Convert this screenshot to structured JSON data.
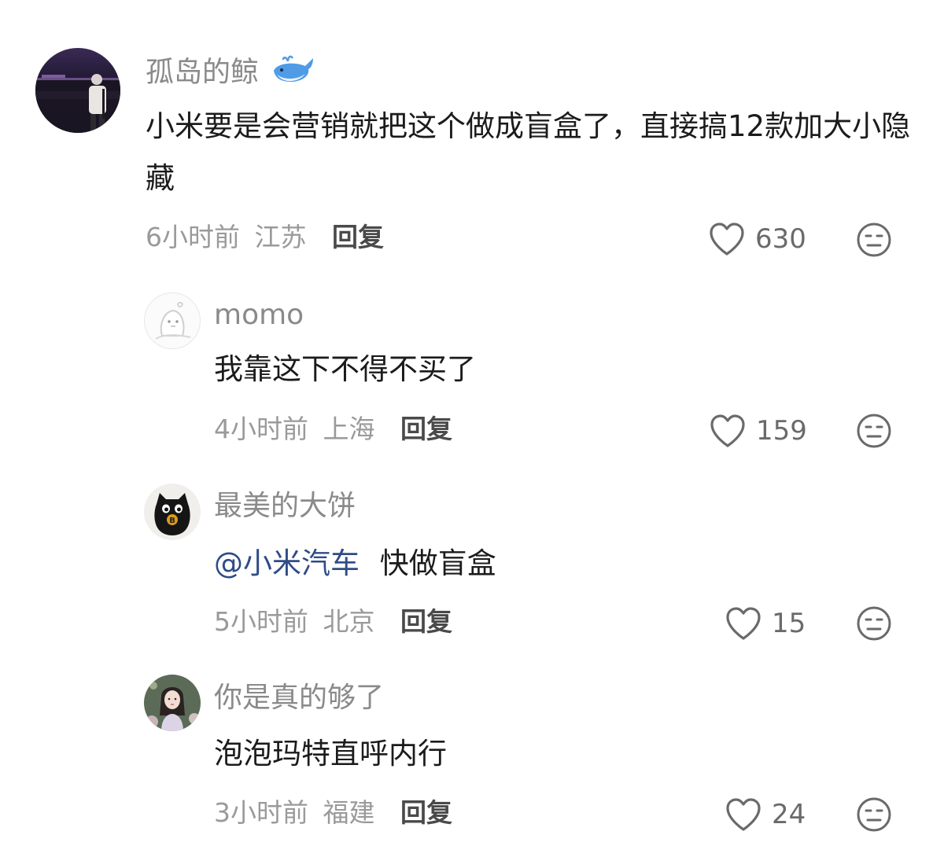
{
  "comments": [
    {
      "username": "孤岛的鲸",
      "username_emoji": "whale-emoji",
      "text": "小米要是会营销就把这个做成盲盒了，直接搞12款加大小隐藏",
      "time": "6小时前",
      "location": "江苏",
      "reply_label": "回复",
      "likes": "630"
    },
    {
      "username": "momo",
      "text": "我靠这下不得不买了",
      "time": "4小时前",
      "location": "上海",
      "reply_label": "回复",
      "likes": "159"
    },
    {
      "username": "最美的大饼",
      "mention": "@小米汽车",
      "text": "快做盲盒",
      "time": "5小时前",
      "location": "北京",
      "reply_label": "回复",
      "likes": "15"
    },
    {
      "username": "你是真的够了",
      "text": "泡泡玛特直呼内行",
      "time": "3小时前",
      "location": "福建",
      "reply_label": "回复",
      "likes": "24"
    }
  ],
  "icons": {
    "like": "heart-outline-icon",
    "dislike": "neutral-face-icon"
  },
  "colors": {
    "mention": "#2f4c86",
    "meta": "#9a9a9a",
    "username": "#8a8a8a"
  }
}
